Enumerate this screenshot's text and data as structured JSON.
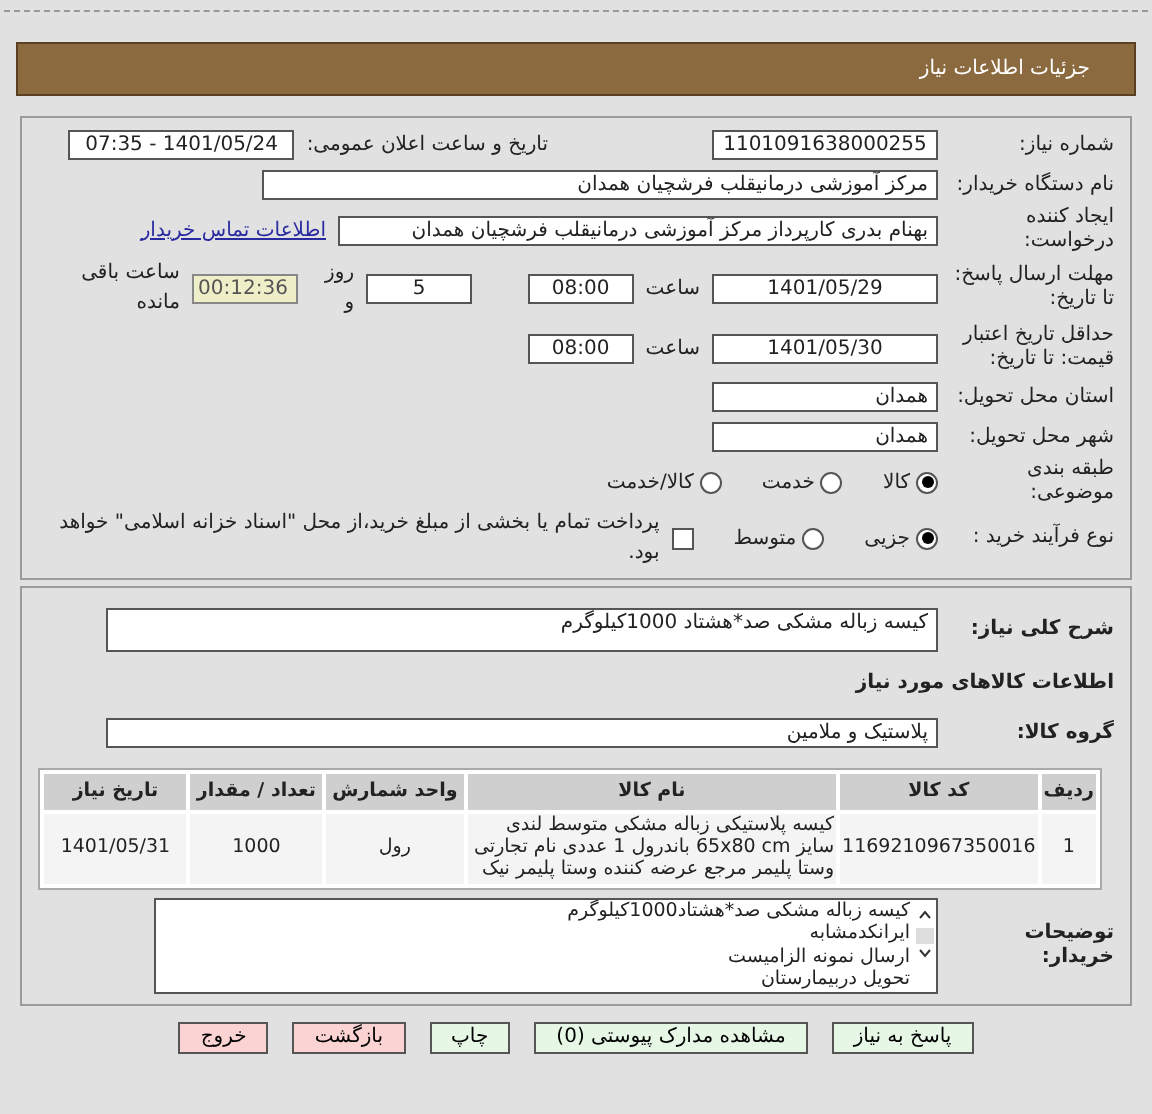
{
  "header": {
    "title": "جزئیات اطلاعات نیاز"
  },
  "details": {
    "need_number": {
      "label": "شماره نیاز:",
      "value": "1101091638000255"
    },
    "announce_datetime": {
      "label": "تاریخ و ساعت اعلان عمومی:",
      "value": "1401/05/24 - 07:35"
    },
    "buyer_org": {
      "label": "نام دستگاه خریدار:",
      "value": "مرکز آموزشی درمانیقلب فرشچیان همدان"
    },
    "requester": {
      "label": "ایجاد کننده درخواست:",
      "value": "بهنام بدری کارپرداز مرکز آموزشی درمانیقلب فرشچیان همدان",
      "link": "اطلاعات تماس خریدار"
    },
    "response_deadline": {
      "label": "مهلت ارسال پاسخ: تا تاریخ:",
      "date": "1401/05/29",
      "time_label": "ساعت",
      "time": "08:00",
      "days": "5",
      "days_label": "روز و",
      "remaining": "00:12:36",
      "remaining_label": "ساعت باقی مانده"
    },
    "price_validity": {
      "label": "حداقل تاریخ اعتبار قیمت: تا تاریخ:",
      "date": "1401/05/30",
      "time_label": "ساعت",
      "time": "08:00"
    },
    "province": {
      "label": "استان محل تحویل:",
      "value": "همدان"
    },
    "city": {
      "label": "شهر محل تحویل:",
      "value": "همدان"
    },
    "category": {
      "label": "طبقه بندی موضوعی:",
      "options": [
        {
          "label": "کالا",
          "selected": true
        },
        {
          "label": "خدمت",
          "selected": false
        },
        {
          "label": "کالا/خدمت",
          "selected": false
        }
      ]
    },
    "purchase_process": {
      "label": "نوع فرآیند خرید :",
      "options": [
        {
          "label": "جزیی",
          "selected": true
        },
        {
          "label": "متوسط",
          "selected": false
        }
      ],
      "payment": {
        "checked": false,
        "label": "پرداخت تمام یا بخشی از مبلغ خرید،از محل \"اسناد خزانه اسلامی\" خواهد بود."
      }
    }
  },
  "need": {
    "description": {
      "label": "شرح کلی نیاز:",
      "value": "کیسه زباله مشکی صد*هشتاد 1000کیلوگرم"
    },
    "goods_title": "اطلاعات کالاهای مورد نیاز",
    "goods_group": {
      "label": "گروه کالا:",
      "value": "پلاستیک و ملامین"
    },
    "table": {
      "columns": [
        "ردیف",
        "کد کالا",
        "نام کالا",
        "واحد شمارش",
        "تعداد / مقدار",
        "تاریخ نیاز"
      ],
      "rows": [
        [
          "1",
          "1169210967350016",
          "کیسه پلاستیکی زباله مشکی متوسط لندی سایز 65x80 cm باندرول 1 عددی نام تجارتی وستا پلیمر مرجع عرضه کننده وستا پلیمر نیک",
          "رول",
          "1000",
          "1401/05/31"
        ]
      ]
    },
    "buyer_notes": {
      "label": "توضیحات خریدار:",
      "lines": [
        "کیسه زباله مشکی صد*هشتاد1000کیلوگرم",
        "ایرانکدمشابه",
        "ارسال نمونه الزامیست",
        "تحویل دربیمارستان"
      ]
    }
  },
  "buttons": [
    {
      "label": "پاسخ به نیاز",
      "kind": "primary"
    },
    {
      "label": "مشاهده مدارک پیوستی (0)",
      "kind": "primary"
    },
    {
      "label": "چاپ",
      "kind": "primary"
    },
    {
      "label": "بازگشت",
      "kind": "danger"
    },
    {
      "label": "خروج",
      "kind": "danger"
    }
  ]
}
